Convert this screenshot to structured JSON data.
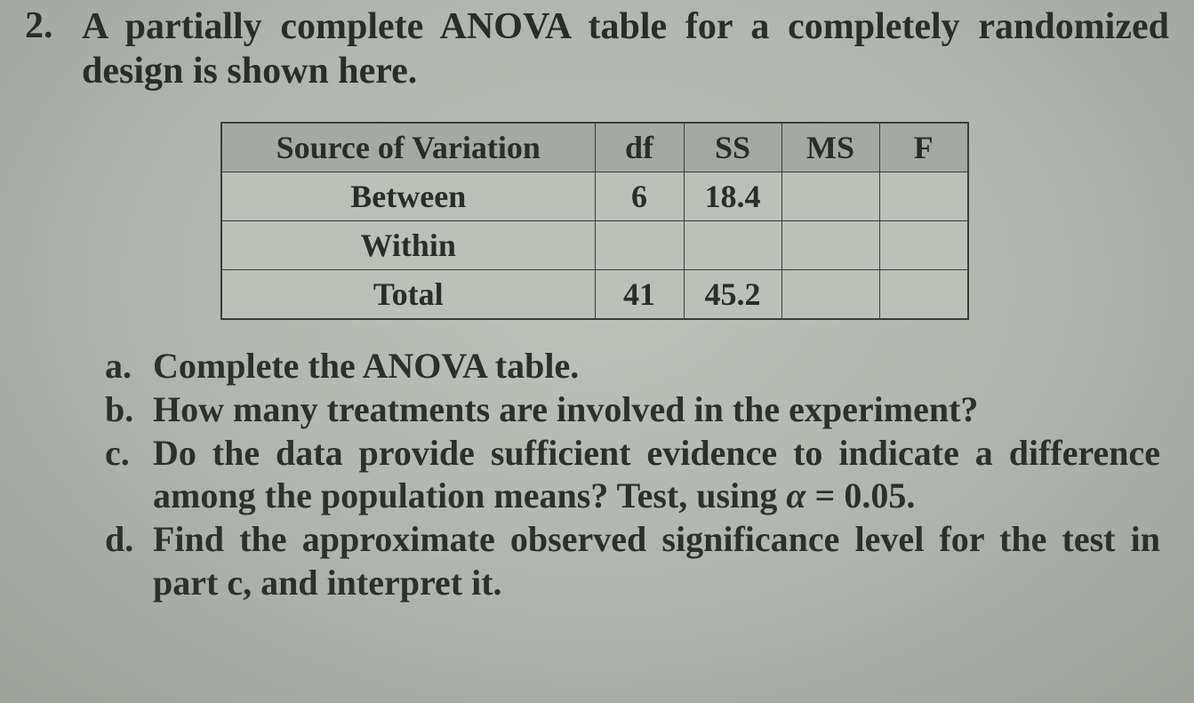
{
  "question": {
    "number": "2.",
    "prompt": "A partially complete ANOVA table for a completely randomized design is shown here."
  },
  "table": {
    "headers": {
      "source": "Source of Variation",
      "df": "df",
      "ss": "SS",
      "ms": "MS",
      "f": "F"
    },
    "rows": [
      {
        "source": "Between",
        "df": "6",
        "ss": "18.4",
        "ms": "",
        "f": ""
      },
      {
        "source": "Within",
        "df": "",
        "ss": "",
        "ms": "",
        "f": ""
      },
      {
        "source": "Total",
        "df": "41",
        "ss": "45.2",
        "ms": "",
        "f": ""
      }
    ]
  },
  "parts": {
    "a": {
      "label": "a.",
      "text": "Complete the ANOVA table."
    },
    "b": {
      "label": "b.",
      "text": "How many treatments are involved in the experiment?"
    },
    "c": {
      "label": "c.",
      "text_pre": "Do the data provide sufficient evidence to indicate a difference among the population means? Test, using ",
      "alpha": "α",
      "eq": " = 0.05."
    },
    "d": {
      "label": "d.",
      "text": "Find the approximate observed significance level for the test in part c, and interpret it."
    }
  }
}
